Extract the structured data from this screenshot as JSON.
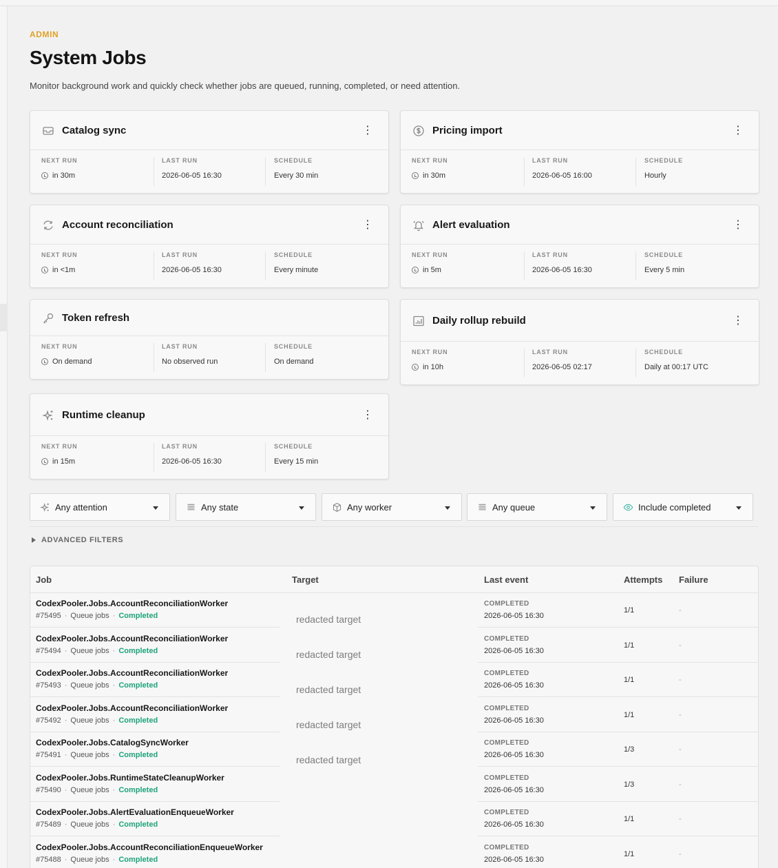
{
  "header": {
    "eyebrow": "ADMIN",
    "title": "System Jobs",
    "description": "Monitor background work and quickly check whether jobs are queued, running, completed, or need attention."
  },
  "labels": {
    "next_run": "NEXT RUN",
    "last_run": "LAST RUN",
    "schedule": "SCHEDULE"
  },
  "menu_glyph": "⋮",
  "cards": [
    {
      "title": "Catalog sync",
      "icon": "inbox-icon",
      "next_run": "in 30m",
      "last_run": "2026-06-05 16:30",
      "schedule": "Every 30 min"
    },
    {
      "title": "Pricing import",
      "icon": "dollar-icon",
      "next_run": "in 30m",
      "last_run": "2026-06-05 16:00",
      "schedule": "Hourly"
    },
    {
      "title": "Account reconciliation",
      "icon": "refresh-icon",
      "next_run": "in <1m",
      "last_run": "2026-06-05 16:30",
      "schedule": "Every minute"
    },
    {
      "title": "Alert evaluation",
      "icon": "bell-icon",
      "next_run": "in 5m",
      "last_run": "2026-06-05 16:30",
      "schedule": "Every 5 min"
    },
    {
      "title": "Token refresh",
      "icon": "key-icon",
      "next_run": "On demand",
      "last_run": "No observed run",
      "schedule": "On demand"
    },
    {
      "title": "Daily rollup rebuild",
      "icon": "chart-icon",
      "next_run": "in 10h",
      "last_run": "2026-06-05 02:17",
      "schedule": "Daily at 00:17 UTC"
    },
    {
      "title": "Runtime cleanup",
      "icon": "sparkle-icon",
      "next_run": "in 15m",
      "last_run": "2026-06-05 16:30",
      "schedule": "Every 15 min"
    }
  ],
  "filters": [
    {
      "label": "Any attention",
      "icon": "sparkle-icon"
    },
    {
      "label": "Any state",
      "icon": "list-icon"
    },
    {
      "label": "Any worker",
      "icon": "cube-icon"
    },
    {
      "label": "Any queue",
      "icon": "list-icon"
    },
    {
      "label": "Include completed",
      "icon": "eye-icon"
    }
  ],
  "advanced_filters": "ADVANCED FILTERS",
  "table": {
    "columns": {
      "job": "Job",
      "target": "Target",
      "last_event": "Last event",
      "attempts": "Attempts",
      "failure": "Failure"
    },
    "targets": [
      "redacted target",
      "redacted target",
      "redacted target",
      "redacted target",
      "redacted target"
    ],
    "rows": [
      {
        "name": "CodexPooler.Jobs.AccountReconciliationWorker",
        "id": "#75495",
        "queue": "Queue jobs",
        "status": "Completed",
        "event": "COMPLETED",
        "time": "2026-06-05 16:30",
        "attempts": "1/1",
        "failure": "-"
      },
      {
        "name": "CodexPooler.Jobs.AccountReconciliationWorker",
        "id": "#75494",
        "queue": "Queue jobs",
        "status": "Completed",
        "event": "COMPLETED",
        "time": "2026-06-05 16:30",
        "attempts": "1/1",
        "failure": "-"
      },
      {
        "name": "CodexPooler.Jobs.AccountReconciliationWorker",
        "id": "#75493",
        "queue": "Queue jobs",
        "status": "Completed",
        "event": "COMPLETED",
        "time": "2026-06-05 16:30",
        "attempts": "1/1",
        "failure": "-"
      },
      {
        "name": "CodexPooler.Jobs.AccountReconciliationWorker",
        "id": "#75492",
        "queue": "Queue jobs",
        "status": "Completed",
        "event": "COMPLETED",
        "time": "2026-06-05 16:30",
        "attempts": "1/1",
        "failure": "-"
      },
      {
        "name": "CodexPooler.Jobs.CatalogSyncWorker",
        "id": "#75491",
        "queue": "Queue jobs",
        "status": "Completed",
        "event": "COMPLETED",
        "time": "2026-06-05 16:30",
        "attempts": "1/3",
        "failure": "-"
      },
      {
        "name": "CodexPooler.Jobs.RuntimeStateCleanupWorker",
        "id": "#75490",
        "queue": "Queue jobs",
        "status": "Completed",
        "event": "COMPLETED",
        "time": "2026-06-05 16:30",
        "attempts": "1/3",
        "failure": "-"
      },
      {
        "name": "CodexPooler.Jobs.AlertEvaluationEnqueueWorker",
        "id": "#75489",
        "queue": "Queue jobs",
        "status": "Completed",
        "event": "COMPLETED",
        "time": "2026-06-05 16:30",
        "attempts": "1/1",
        "failure": "-"
      },
      {
        "name": "CodexPooler.Jobs.AccountReconciliationEnqueueWorker",
        "id": "#75488",
        "queue": "Queue jobs",
        "status": "Completed",
        "event": "COMPLETED",
        "time": "2026-06-05 16:30",
        "attempts": "1/1",
        "failure": "-"
      }
    ]
  },
  "colors": {
    "accent": "#e0a126",
    "completed": "#1ea37a",
    "eye_icon": "#3bb5a5"
  }
}
